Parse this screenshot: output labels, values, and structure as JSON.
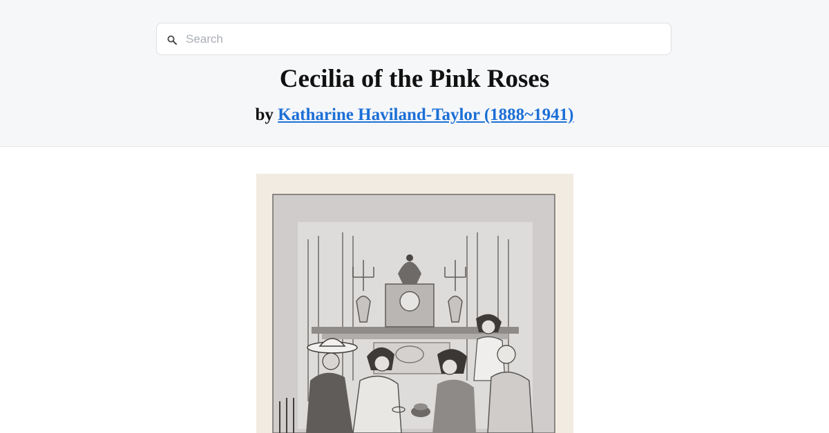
{
  "search": {
    "placeholder": "Search",
    "value": ""
  },
  "book": {
    "title": "Cecilia of the Pink Roses",
    "by_prefix": "by",
    "author_link": "Katharine Haviland-Taylor (1888~1941)"
  },
  "colors": {
    "header_bg": "#f6f7f9",
    "link": "#1b6fd6",
    "text": "#111111"
  }
}
